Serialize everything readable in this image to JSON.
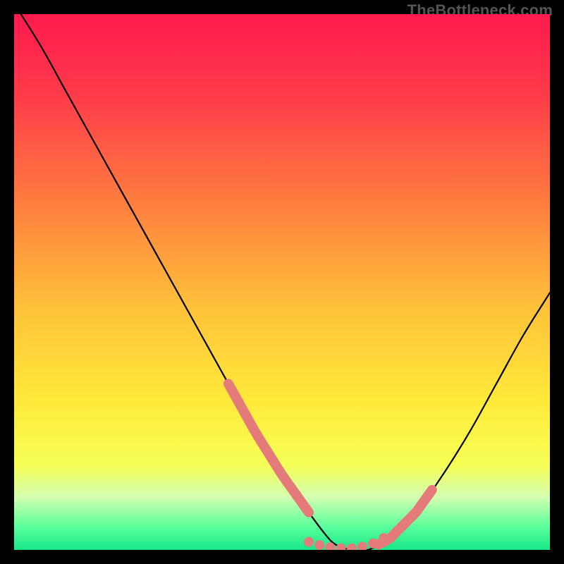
{
  "watermark": "TheBottleneck.com",
  "colors": {
    "bg": "#000000",
    "gradient_stops": [
      {
        "offset": 0.0,
        "color": "#ff1a4e"
      },
      {
        "offset": 0.15,
        "color": "#ff3a4a"
      },
      {
        "offset": 0.35,
        "color": "#ff7d3f"
      },
      {
        "offset": 0.55,
        "color": "#ffc23a"
      },
      {
        "offset": 0.72,
        "color": "#ffe93a"
      },
      {
        "offset": 0.84,
        "color": "#f6ff55"
      },
      {
        "offset": 0.9,
        "color": "#d6ffb0"
      },
      {
        "offset": 0.955,
        "color": "#5eff9d"
      },
      {
        "offset": 1.0,
        "color": "#17e88a"
      }
    ],
    "curve": "#000000",
    "thick_segment": "#e47a7a"
  },
  "chart_data": {
    "type": "line",
    "title": "",
    "xlabel": "",
    "ylabel": "",
    "xlim": [
      0,
      100
    ],
    "ylim": [
      0,
      100
    ],
    "series": [
      {
        "name": "bottleneck-curve",
        "x": [
          0,
          5,
          10,
          15,
          20,
          25,
          30,
          35,
          40,
          45,
          50,
          55,
          58,
          60,
          63,
          66,
          70,
          75,
          80,
          85,
          90,
          95,
          100
        ],
        "y": [
          102,
          94,
          85,
          76,
          67,
          58,
          49,
          40,
          31,
          22,
          14,
          7,
          3,
          1,
          0,
          0,
          2,
          7,
          14,
          22,
          31,
          40,
          48
        ]
      }
    ],
    "highlight_segments": [
      {
        "name": "left-thick",
        "x_start": 40,
        "x_end": 55
      },
      {
        "name": "right-thick",
        "x_start": 68,
        "x_end": 78
      }
    ],
    "floor_dots": {
      "x": [
        55,
        57,
        59,
        61,
        63,
        65,
        67,
        69
      ],
      "y": [
        1.5,
        0.9,
        0.5,
        0.3,
        0.3,
        0.6,
        1.2,
        2.2
      ]
    }
  }
}
